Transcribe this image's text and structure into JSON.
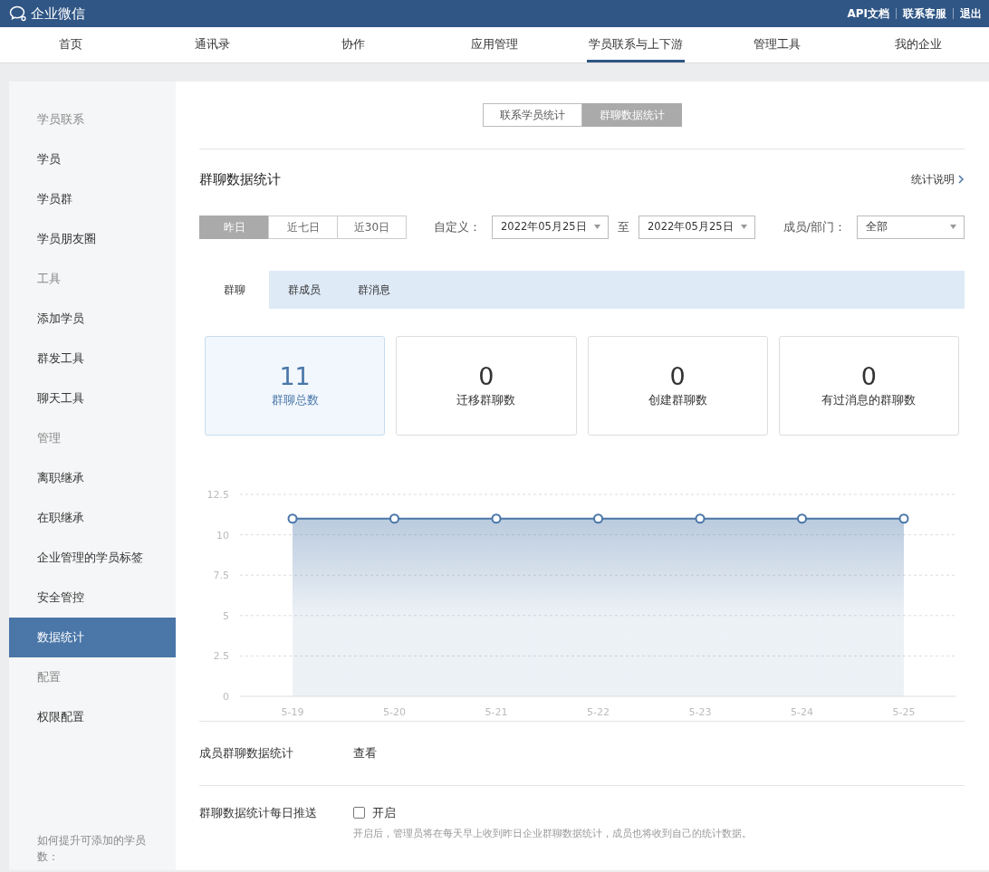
{
  "topbar": {
    "logo": "企业微信",
    "links": [
      "API文档",
      "联系客服",
      "退出"
    ]
  },
  "nav": [
    {
      "label": "首页",
      "selected": false
    },
    {
      "label": "通讯录",
      "selected": false
    },
    {
      "label": "协作",
      "selected": false
    },
    {
      "label": "应用管理",
      "selected": false
    },
    {
      "label": "学员联系与上下游",
      "selected": true
    },
    {
      "label": "管理工具",
      "selected": false
    },
    {
      "label": "我的企业",
      "selected": false
    }
  ],
  "sidebar": {
    "groups": [
      {
        "title": "学员联系",
        "items": [
          {
            "label": "学员",
            "selected": false
          },
          {
            "label": "学员群",
            "selected": false
          },
          {
            "label": "学员朋友圈",
            "selected": false
          }
        ]
      },
      {
        "title": "工具",
        "items": [
          {
            "label": "添加学员",
            "selected": false
          },
          {
            "label": "群发工具",
            "selected": false
          },
          {
            "label": "聊天工具",
            "selected": false
          }
        ]
      },
      {
        "title": "管理",
        "items": [
          {
            "label": "离职继承",
            "selected": false
          },
          {
            "label": "在职继承",
            "selected": false
          },
          {
            "label": "企业管理的学员标签",
            "selected": false
          },
          {
            "label": "安全管控",
            "selected": false
          },
          {
            "label": "数据统计",
            "selected": true
          }
        ]
      },
      {
        "title": "配置",
        "items": [
          {
            "label": "权限配置",
            "selected": false
          }
        ]
      }
    ],
    "footer": "如何提升可添加的学员数："
  },
  "switch": [
    {
      "label": "联系学员统计",
      "selected": false
    },
    {
      "label": "群聊数据统计",
      "selected": true
    }
  ],
  "section": {
    "title": "群聊数据统计",
    "help_link": "统计说明"
  },
  "ranges": [
    {
      "label": "昨日",
      "selected": true
    },
    {
      "label": "近七日",
      "selected": false
    },
    {
      "label": "近30日",
      "selected": false
    }
  ],
  "custom": {
    "label": "自定义：",
    "from": "2022年05月25日",
    "to_label": "至",
    "to": "2022年05月25日"
  },
  "member": {
    "label": "成员/部门：",
    "value": "全部"
  },
  "tabs": [
    {
      "label": "群聊",
      "selected": true
    },
    {
      "label": "群成员",
      "selected": false
    },
    {
      "label": "群消息",
      "selected": false
    }
  ],
  "stats": [
    {
      "value": "11",
      "label": "群聊总数",
      "selected": true
    },
    {
      "value": "0",
      "label": "迁移群聊数",
      "selected": false
    },
    {
      "value": "0",
      "label": "创建群聊数",
      "selected": false
    },
    {
      "value": "0",
      "label": "有过消息的群聊数",
      "selected": false
    }
  ],
  "chart_data": {
    "type": "area",
    "categories": [
      "5-19",
      "5-20",
      "5-21",
      "5-22",
      "5-23",
      "5-24",
      "5-25"
    ],
    "series": [
      {
        "color": "#4a76a8",
        "values": [
          11,
          11,
          11,
          11,
          11,
          11,
          11
        ]
      }
    ],
    "grid": true,
    "ylim": [
      0,
      12.5
    ],
    "yticks": [
      0,
      2.5,
      5,
      7.5,
      10,
      12.5
    ]
  },
  "member_stats": {
    "label": "成员群聊数据统计",
    "link": "查看"
  },
  "daily_push": {
    "label": "群聊数据统计每日推送",
    "option": "开启",
    "checked": false,
    "note": "开启后，管理员将在每天早上收到昨日企业群聊数据统计，成员也将收到自己的统计数据。"
  }
}
